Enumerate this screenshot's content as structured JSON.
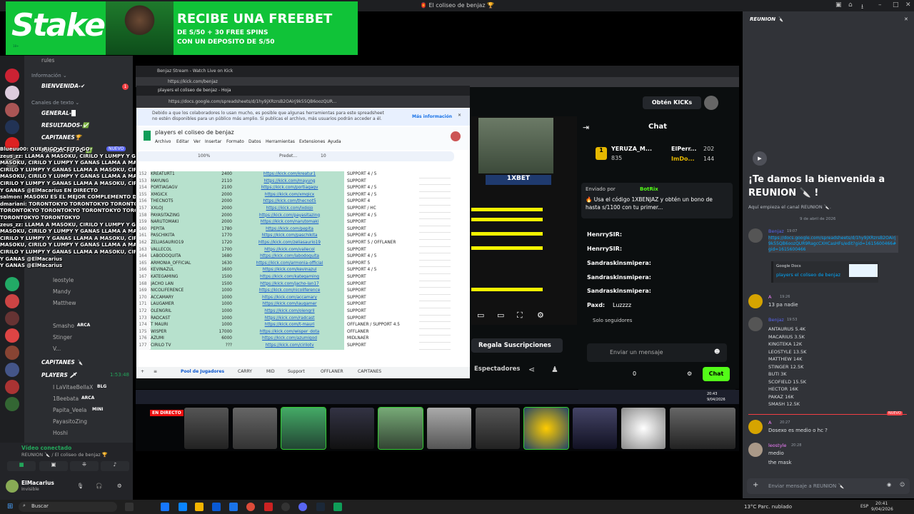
{
  "window": {
    "title": "🏮 El coliseo de benjaz 🏆"
  },
  "banner": {
    "brand": "Stake",
    "line1": "RECIBE UNA FREEBET",
    "line2": "DE S/50 + 30 FREE SPINS",
    "line3": "CON UN DEPOSITO DE S/50",
    "age": "18+"
  },
  "discord_left": {
    "rules": "rules",
    "info_cat": "Información ⌄",
    "bienvenida": "BIENVENIDA-✔",
    "text_cat": "Canales de texto ⌄",
    "general": "GENERAL-█",
    "resultados": "RESULTADOS-✅",
    "capitanes": "CAPITANES🏆",
    "mandafc": "MANDA TU FC-✅",
    "nuevo": "NUEVO",
    "voice_users": [
      "leostyle",
      "Mandy",
      "Matthew",
      "Smasho",
      "Stinger",
      "V..."
    ],
    "smasho_tag": "ARCA",
    "cap_channel": "CAPITANES 🔪",
    "players_channel": "PLAYERS 🗡",
    "players_time": "1:53:48",
    "players_users": [
      "I LaVitaeBellaX",
      "1Beebata",
      "Papita_Veela",
      "PayasitoZing",
      "Hoshi"
    ],
    "players_tags": [
      "BLG",
      "ARCA",
      "MINI"
    ],
    "voice_connected": "Vídeo conectado",
    "voice_channel": "REUNION 🔪 / El coliseo de benjaz 🏆",
    "user_name": "ElMacarius",
    "user_status": "Invisible"
  },
  "overlay_chat": [
    "Blueuu00: QUE RICO ACEITO GO",
    "zeus_zz: LLAMA A MASOKU, CIRILO Y LUMPY Y GANAS",
    "MASOKU, CIRILO Y LUMPY Y GANAS LLAMA A MASOKU,",
    "CIRILO Y LUMPY Y GANAS LLAMA A MASOKU, CIRILO Y LUMPY",
    "MASOKU, CIRILO Y LUMPY Y GANAS LLAMA A MASOKU,",
    "CIRILO Y LUMPY Y GANAS LLAMA A MASOKU, CIRILO Y LUMPY",
    "Y GANAS @ElMacarius EN DIRECTO",
    "salmon: MASOKU ES EL MEJOR COMPLEMENTO DE LUMPY",
    "dmariani: TORONTOKYO TORONTOKYO TORONTOKYO TORONTOKYO",
    "TORONTOKYO TORONTOKYO TORONTOKYO TORONTOKYO TORONTOKYO",
    "TORONTOKYO TORONTOKYO",
    "zeus_zz: LLAMA A MASOKU, CIRILO Y LUMPY Y GANAS",
    "MASOKU, CIRILO Y LUMPY Y GANAS LLAMA A MASOKU,",
    "CIRILO Y LUMPY Y GANAS LLAMA A MASOKU, CIRILO Y LUMPY",
    "MASOKU, CIRILO Y LUMPY Y GANAS LLAMA A MASOKU,",
    "CIRILO Y LUMPY Y GANAS LLAMA A MASOKU, CIRILO Y LUMPY",
    "Y GANAS @ElMacarius",
    "Y GANAS @ElMacarius"
  ],
  "kick": {
    "tab": "Benjaz Stream - Watch Live on Kick",
    "url": "https://kick.com/benjaz",
    "obtain": "Obtén KICKs",
    "chat_title": "Chat",
    "top1_name": "YERUZA_M...",
    "top1_val": "835",
    "top2_name": "ElPerr...",
    "top2_val": "202",
    "top3_name": "ImDo...",
    "top3_val": "144",
    "pinned_by": "Enviado por",
    "pinned_user": "BotRix",
    "pinned_msg": "🔥 Usa el código 1XBENJAZ y obtén un bono de hasta s/1100 con tu primer...",
    "messages": [
      {
        "user": "HenrrySIR:",
        "text": ""
      },
      {
        "user": "HenrrySIR:",
        "text": ""
      },
      {
        "user": "Sandraskinsmipera:",
        "text": ""
      },
      {
        "user": "Sandraskinsmipera:",
        "text": ""
      },
      {
        "user": "Sandraskinsmipera:",
        "text": ""
      },
      {
        "user": "Paxd:",
        "text": "Luzzzz"
      }
    ],
    "followers_only": "Solo seguidores",
    "input_placeholder": "Enviar un mensaje",
    "count": "0",
    "chat_button": "Chat",
    "gift_subs": "Regala Suscripciones",
    "viewers": "Espectadores",
    "live": "EN DIRECTO",
    "bet_logo": "1XBET"
  },
  "sheet": {
    "tab": "players el coliseo de benjaz - Hoja",
    "url": "https://docs.google.com/spreadsheets/d/1hy9jXRzrsB2OAirj9k55QB6oozQUR...",
    "notice": "Debido a que los colaboradores lo usan mucho, es posible que algunas herramientas para este spreadsheet no estén disponibles para un público más amplio. Si publicas el archivo, más usuarios podrán acceder a él.",
    "more_info": "Más información",
    "title": "players el coliseo de benjaz",
    "menus": [
      "Archivo",
      "Editar",
      "Ver",
      "Insertar",
      "Formato",
      "Datos",
      "Herramientas",
      "Extensiones",
      "Ayuda"
    ],
    "zoom": "100%",
    "font": "Predet...",
    "fontsize": "10",
    "rows": [
      [
        "152",
        "KREATURT1",
        "2400",
        "https://kick.com/kreatur1",
        "SUPPORT 4 / 5"
      ],
      [
        "153",
        "MAYUNG",
        "2110",
        "https://kick.com/mayung",
        "SUPPORT"
      ],
      [
        "154",
        "PORTIAGAGV",
        "2100",
        "https://kick.com/portiagagv",
        "SUPPORT 4 / 5"
      ],
      [
        "155",
        "XMGICX",
        "2000",
        "https://kick.com/xmgicx",
        "SUPPORT 4 / 5"
      ],
      [
        "156",
        "THECNOT5",
        "2000",
        "https://kick.com/thecnot5",
        "SUPPORT 4"
      ],
      [
        "157",
        "XXLOJ",
        "2000",
        "https://kick.com/lxdojo",
        "SUPPORT / HC"
      ],
      [
        "158",
        "PAYASITAZING",
        "2000",
        "https://kick.com/payasitazing",
        "SUPPORT 4 / 5"
      ],
      [
        "159",
        "NARUTOMAKI",
        "2000",
        "https://kick.com/narutomaki",
        "SUPPORT"
      ],
      [
        "160",
        "PEPITA",
        "1780",
        "https://kick.com/pepita",
        "SUPPORT"
      ],
      [
        "161",
        "PASCHIKITA",
        "1770",
        "https://kick.com/paschikita",
        "SUPPORT 4 / 5"
      ],
      [
        "162",
        "ZELIASAURIO19",
        "1720",
        "https://kick.com/zeliasaurio19",
        "SUPPORT 5 / OFFLANER"
      ],
      [
        "163",
        "VALLECOL",
        "1700",
        "https://kick.com/vallecol",
        "SUPPORT"
      ],
      [
        "164",
        "LABODOQUITA",
        "1680",
        "https://kick.com/labodoquita",
        "SUPPORT 4 / 5"
      ],
      [
        "165",
        "ARMONIA_OFFICIAL",
        "1630",
        "https://kick.com/armonia-official",
        "SUPPORT 5"
      ],
      [
        "166",
        "KEVINAZUL",
        "1600",
        "https://kick.com/kevinazul",
        "SUPPORT 4 / 5"
      ],
      [
        "167",
        "KATEGAMING",
        "1500",
        "https://kick.com/kategaming",
        "SUPPORT"
      ],
      [
        "168",
        "JACHO LAN",
        "1500",
        "https://kick.com/jacho-lan17",
        "SUPPORT"
      ],
      [
        "169",
        "NICOLIFERENCE",
        "1000",
        "https://kick.com/nicoliference",
        "SUPPORT"
      ],
      [
        "170",
        "ACCAMARY",
        "1000",
        "https://kick.com/accamary",
        "SUPPORT"
      ],
      [
        "171",
        "LAUGAMER",
        "1000",
        "https://kick.com/laugamer",
        "SUPPORT"
      ],
      [
        "172",
        "OLENGRIL",
        "1000",
        "https://kick.com/olengril",
        "SUPPORT"
      ],
      [
        "173",
        "RADCAST",
        "1000",
        "https://kick.com/radcast",
        "SUPPORT"
      ],
      [
        "174",
        "T MAURI",
        "1000",
        "https://kick.com/t-mauri",
        "OFFLANER / SUPPORT 4.5"
      ],
      [
        "175",
        "WISPER",
        "17000",
        "https://kick.com/wisper_dota",
        "OFFLANER"
      ],
      [
        "176",
        "AZUMI",
        "6000",
        "https://kick.com/azumigod",
        "MIDLNAER"
      ],
      [
        "177",
        "CIRILO TV",
        "???",
        "https://kick.com/cirilotv",
        "SUPPORT"
      ]
    ],
    "sheet_tabs": [
      "Pool de Jugadores",
      "CARRY",
      "MID",
      "Support",
      "OFFLANER",
      "CAPITANES"
    ]
  },
  "right_chat": {
    "channel": "REUNION 🔪",
    "welcome_title": "¡Te damos la bienvenida a REUNION 🔪 !",
    "welcome_sub": "Aquí empieza el canal REUNION 🔪.",
    "date_sep": "9 de abril de 2026",
    "msg1_user": "Benjaz",
    "msg1_time": "19:07",
    "msg1_link": "https://docs.google.com/spreadsheets/d/1hy9jXRzrsB2OAirj9k55QB6oozQUR9RagcCXHCasHFs/edit?gid=1615600466#gid=1615600466",
    "embed_site": "Google Docs",
    "embed_title": "players el coliseo de benjaz",
    "msg2_user": "A",
    "msg2_time": "19:26",
    "msg2_text": "13 pa nadie",
    "msg3_user": "Benjaz",
    "msg3_time": "19:53",
    "msg3_lines": [
      "ANTAURUS 5.4K",
      "MACARIUS 3.5K",
      "KINGTEKA 12K",
      "LEOSTYLE 13.5K",
      "MATTHEW 14K",
      "STINGER 12.5K",
      "BUTI 3K",
      "SCOFIELD 15.5K",
      "HECTOR 16K",
      "PAKAZ 16K",
      "SMASH 12.5K"
    ],
    "new_label": "NUEVO",
    "msg4_user": "A",
    "msg4_time": "20:27",
    "msg4_text": "Dosexo es medio o hc ?",
    "msg5_user": "leostyle",
    "msg5_time": "20:28",
    "msg5_lines": [
      "medio",
      "the mask"
    ],
    "input_placeholder": "Enviar mensaje a REUNION 🔪"
  },
  "taskbar": {
    "search": "Buscar",
    "weather": "13°C Parc. nublado",
    "lang": "ESP",
    "time": "20:41",
    "date": "9/04/2026",
    "inner_time": "20:43",
    "inner_date": "9/04/2026"
  },
  "colors": {
    "stake_green": "#10c338",
    "kick_green": "#53fc18",
    "discord_bg": "#313338",
    "sheet_green": "#b7e1cd",
    "sheet_blue": "#a4c2f4"
  }
}
